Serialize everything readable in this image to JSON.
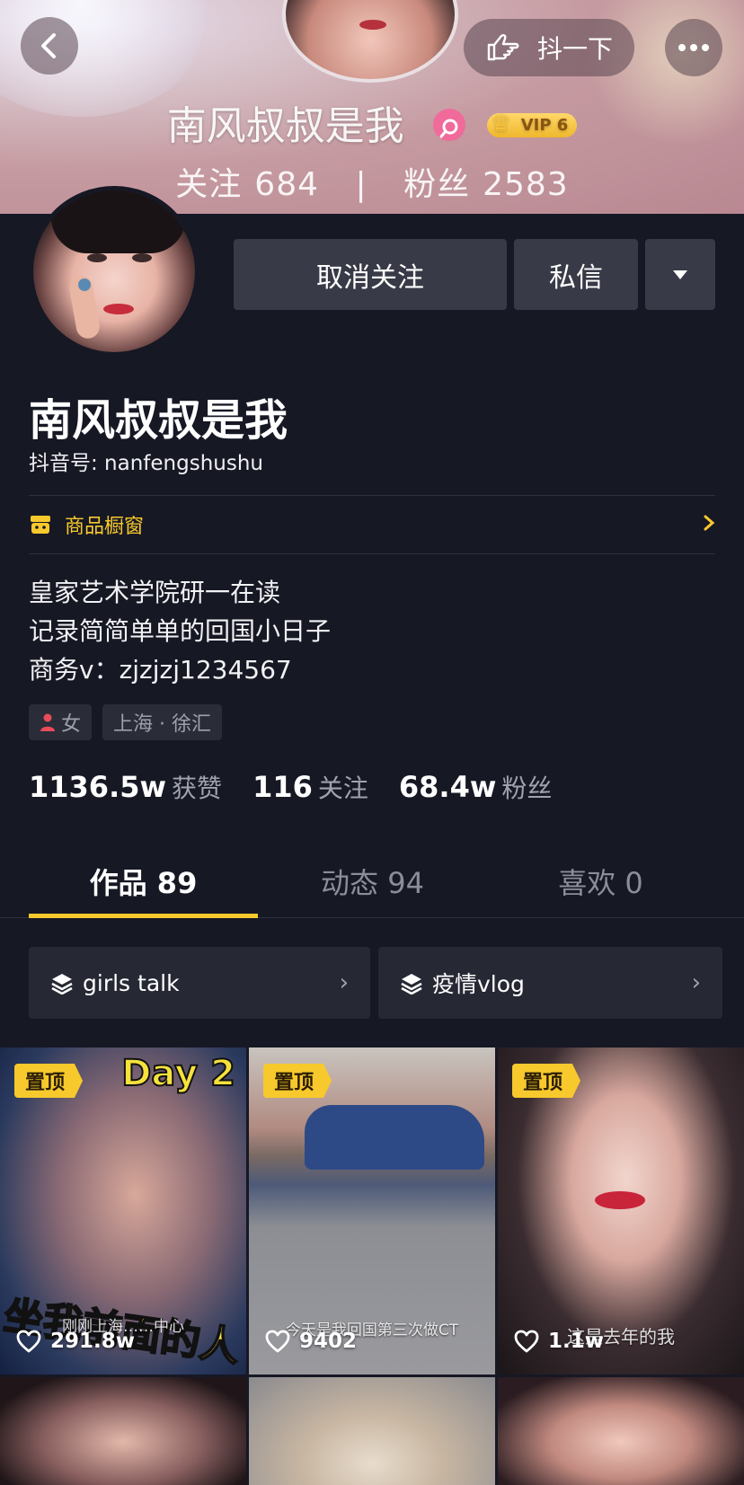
{
  "header": {
    "shake_label": "抖一下",
    "banner_name": "南风叔叔是我",
    "vip_label": "VIP 6",
    "banner_following_label": "关注",
    "banner_following": "684",
    "banner_sep": "|",
    "banner_fans_label": "粉丝",
    "banner_fans": "2583"
  },
  "actions": {
    "unfollow": "取消关注",
    "message": "私信"
  },
  "profile": {
    "name": "南风叔叔是我",
    "douyin_id": "抖音号: nanfengshushu",
    "shop_label": "商品橱窗",
    "bio": [
      "皇家艺术学院研一在读",
      "记录简简单单的回国小日子",
      "商务v：zjzjzj1234567"
    ],
    "gender": "女",
    "location": "上海 · 徐汇"
  },
  "stats": [
    {
      "num": "1136.5w",
      "label": "获赞"
    },
    {
      "num": "116",
      "label": "关注"
    },
    {
      "num": "68.4w",
      "label": "粉丝"
    }
  ],
  "tabs": [
    {
      "label": "作品 89",
      "active": true
    },
    {
      "label": "动态 94",
      "active": false
    },
    {
      "label": "喜欢 0",
      "active": false
    }
  ],
  "collections": [
    "girls talk",
    "疫情vlog"
  ],
  "videos": [
    {
      "pinned": "置顶",
      "likes": "291.8w",
      "overlay_top": "Day 2",
      "overlay_big": "坐我前面的人",
      "caption": "刚刚上海……中心"
    },
    {
      "pinned": "置顶",
      "likes": "9402",
      "caption": "今天是我回国第三次做CT"
    },
    {
      "pinned": "置顶",
      "likes": "1.1w",
      "caption": "这是去年的我"
    }
  ],
  "colors": {
    "background": "#161824",
    "accent_yellow": "#f8c92c",
    "button_bg": "#383a47"
  }
}
